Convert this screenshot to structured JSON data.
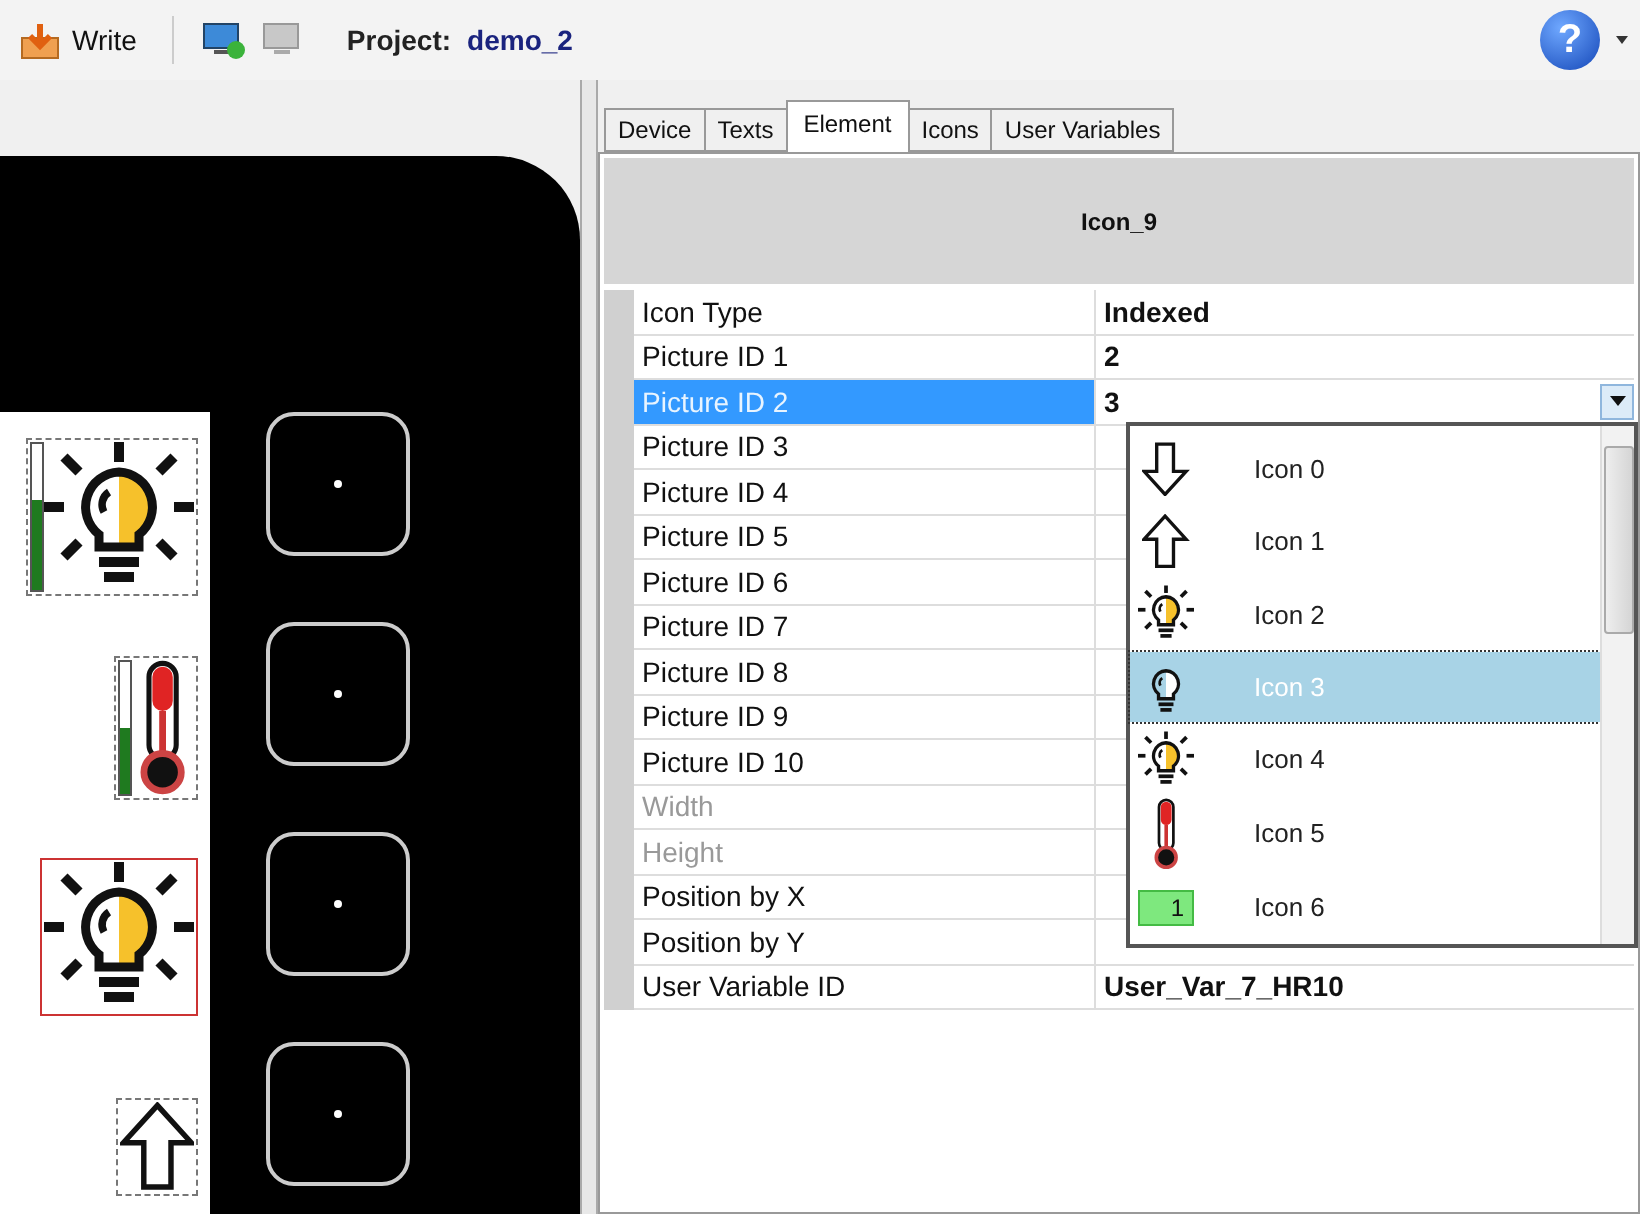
{
  "toolbar": {
    "write_label": "Write",
    "project_label": "Project:",
    "project_name": "demo_2",
    "help_label": "?"
  },
  "tabs": [
    {
      "label": "Device",
      "selected": false
    },
    {
      "label": "Texts",
      "selected": false
    },
    {
      "label": "Element",
      "selected": true
    },
    {
      "label": "Icons",
      "selected": false
    },
    {
      "label": "User Variables",
      "selected": false
    }
  ],
  "canvas": {
    "elements": [
      {
        "kind": "bulb",
        "level": 0.62,
        "selected": false
      },
      {
        "kind": "thermometer",
        "level": 0.5,
        "selected": false
      },
      {
        "kind": "bulb",
        "selected": true
      },
      {
        "kind": "arrow-up",
        "selected": false
      }
    ]
  },
  "properties": {
    "title": "Icon_9",
    "rows": [
      {
        "label": "Icon Type",
        "value": "Indexed",
        "selected": false,
        "disabled": false
      },
      {
        "label": "Picture ID 1",
        "value": "2",
        "selected": false,
        "disabled": false
      },
      {
        "label": "Picture ID 2",
        "value": "3",
        "selected": true,
        "disabled": false
      },
      {
        "label": "Picture ID 3",
        "selected": false,
        "disabled": false
      },
      {
        "label": "Picture ID 4",
        "selected": false,
        "disabled": false
      },
      {
        "label": "Picture ID 5",
        "selected": false,
        "disabled": false
      },
      {
        "label": "Picture ID 6",
        "selected": false,
        "disabled": false
      },
      {
        "label": "Picture ID 7",
        "selected": false,
        "disabled": false
      },
      {
        "label": "Picture ID 8",
        "selected": false,
        "disabled": false
      },
      {
        "label": "Picture ID 9",
        "selected": false,
        "disabled": false
      },
      {
        "label": "Picture ID 10",
        "selected": false,
        "disabled": false
      },
      {
        "label": "Width",
        "selected": false,
        "disabled": true
      },
      {
        "label": "Height",
        "selected": false,
        "disabled": true
      },
      {
        "label": "Position by X",
        "selected": false,
        "disabled": false
      },
      {
        "label": "Position by Y",
        "selected": false,
        "disabled": false
      },
      {
        "label": "User Variable ID",
        "value": "User_Var_7_HR10",
        "selected": false,
        "disabled": false
      }
    ]
  },
  "dropdown": {
    "options": [
      {
        "label": "Icon 0",
        "kind": "arrow-down",
        "selected": false
      },
      {
        "label": "Icon 1",
        "kind": "arrow-up",
        "selected": false
      },
      {
        "label": "Icon 2",
        "kind": "bulb",
        "selected": false
      },
      {
        "label": "Icon 3",
        "kind": "bulb-outline",
        "selected": true
      },
      {
        "label": "Icon 4",
        "kind": "bulb",
        "selected": false
      },
      {
        "label": "Icon 5",
        "kind": "thermometer",
        "selected": false
      },
      {
        "label": "Icon 6",
        "kind": "digit",
        "digit": "1",
        "selected": false
      }
    ]
  }
}
